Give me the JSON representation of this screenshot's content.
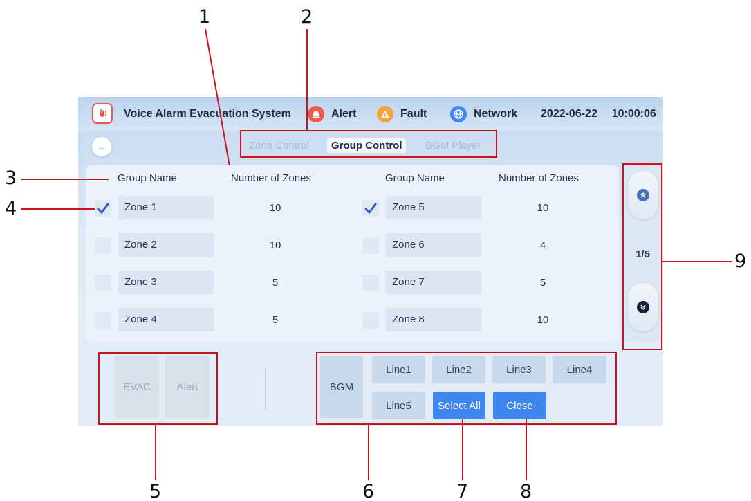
{
  "header": {
    "title": "Voice Alarm Evacuation System",
    "alert_label": "Alert",
    "fault_label": "Fault",
    "network_label": "Network",
    "date": "2022-06-22",
    "time": "10:00:06"
  },
  "nav": {
    "back_icon": "back-arrow-icon",
    "tabs": [
      {
        "label": "Zone Control",
        "active": false
      },
      {
        "label": "Group Control",
        "active": true
      },
      {
        "label": "BGM Player",
        "active": false
      }
    ]
  },
  "table": {
    "headers": {
      "group_name": "Group Name",
      "num_zones": "Number of Zones"
    },
    "rows": [
      {
        "name": "Zone 1",
        "zones": "10",
        "checked": true
      },
      {
        "name": "Zone 2",
        "zones": "10",
        "checked": false
      },
      {
        "name": "Zone 3",
        "zones": "5",
        "checked": false
      },
      {
        "name": "Zone 4",
        "zones": "5",
        "checked": false
      },
      {
        "name": "Zone 5",
        "zones": "10",
        "checked": true
      },
      {
        "name": "Zone 6",
        "zones": "4",
        "checked": false
      },
      {
        "name": "Zone 7",
        "zones": "5",
        "checked": false
      },
      {
        "name": "Zone 8",
        "zones": "10",
        "checked": false
      }
    ]
  },
  "pager": {
    "indicator": "1/5",
    "up_icon": "chevron-up-icon",
    "down_icon": "chevron-down-icon"
  },
  "controls": {
    "evac": "EVAC",
    "alert": "Alert",
    "bgm": "BGM",
    "lines": [
      "Line1",
      "Line2",
      "Line3",
      "Line4",
      "Line5"
    ],
    "select_all": "Select All",
    "close": "Close"
  },
  "callouts": [
    "1",
    "2",
    "3",
    "4",
    "5",
    "6",
    "7",
    "8",
    "9"
  ],
  "colors": {
    "highlight": "#c8141e",
    "primary_button": "#3f86ee",
    "alert_icon": "#ec5a4b",
    "fault_icon": "#f4a53a",
    "network_icon": "#3f86ee",
    "check": "#2a5cc2"
  }
}
